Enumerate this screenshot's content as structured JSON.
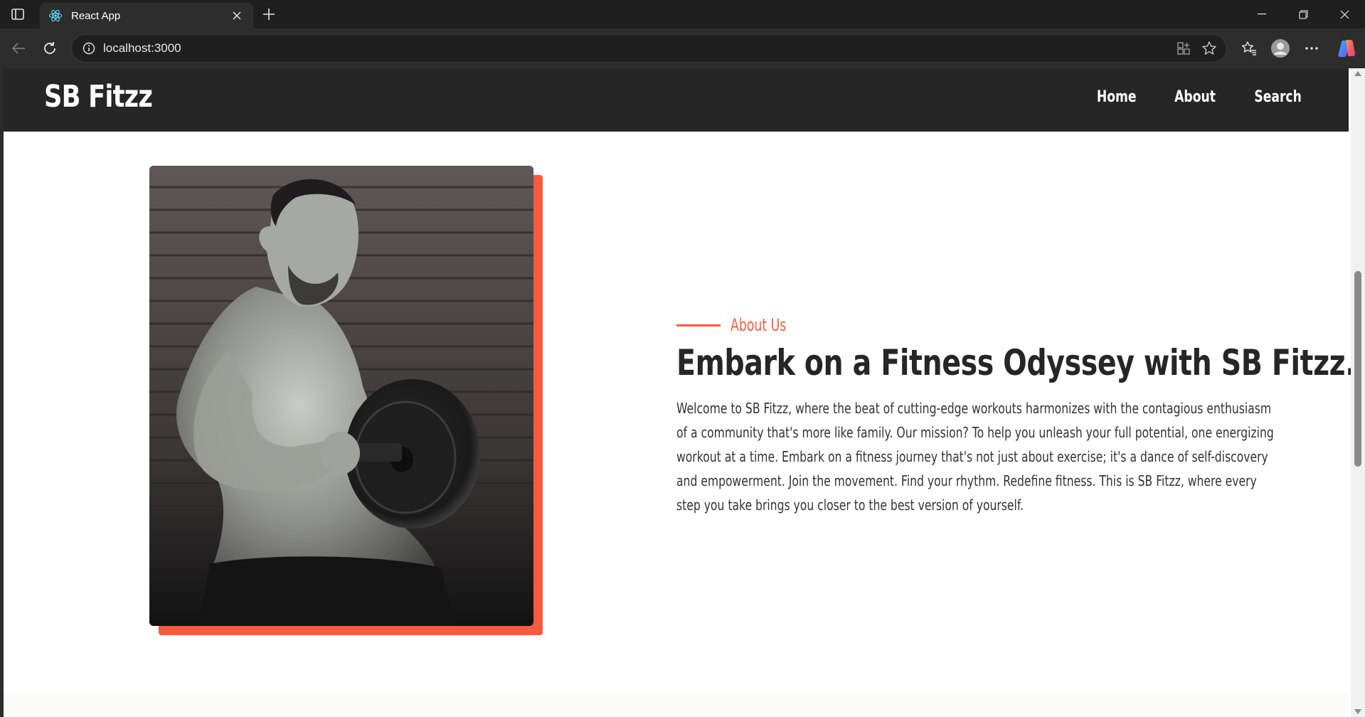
{
  "browser": {
    "tab_title": "React App",
    "url": "localhost:3000"
  },
  "site": {
    "logo": "SB Fitzz",
    "nav": [
      "Home",
      "About",
      "Search"
    ]
  },
  "about": {
    "eyebrow": "About Us",
    "headline": "Embark on a Fitness Odyssey with SB Fitzz..",
    "body": "Welcome to SB Fitzz, where the beat of cutting-edge workouts harmonizes with the contagious enthusiasm of a community that's more like family. Our mission? To help you unleash your full potential, one energizing workout at a time. Embark on a fitness journey that's not just about exercise; it's a dance of self-discovery and empowerment. Join the movement. Find your rhythm. Redefine fitness. This is SB Fitzz, where every step you take brings you closer to the best version of yourself.",
    "image_alt": "Man lifting a dumbbell"
  },
  "colors": {
    "accent": "#f75b3d",
    "header_bg": "#262626",
    "text_dark": "#262626"
  }
}
